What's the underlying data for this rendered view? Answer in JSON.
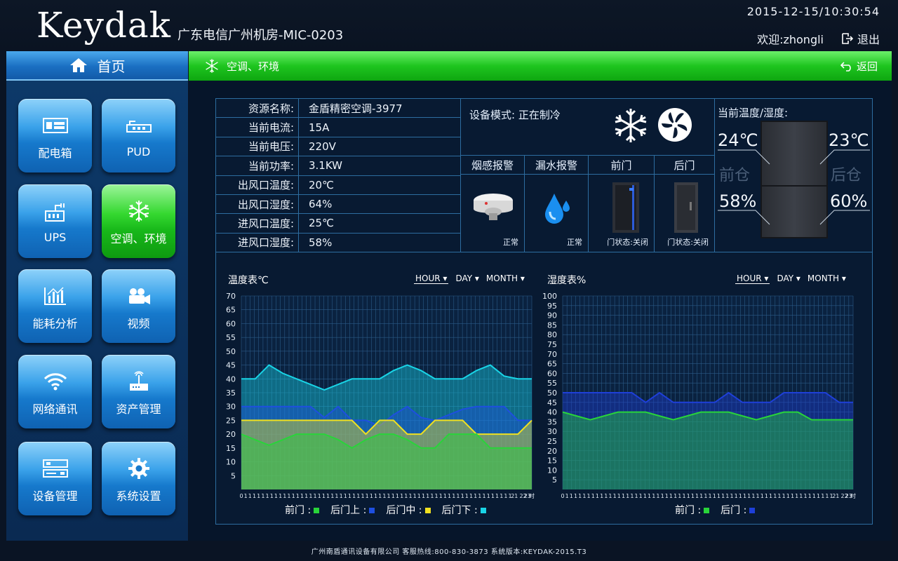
{
  "header": {
    "logo": "Keydak",
    "site_name": "广东电信广州机房-MIC-0203",
    "datetime": "2015-12-15/10:30:54",
    "welcome": "欢迎:zhongli",
    "logout": "退出"
  },
  "sidebar": {
    "home": "首页",
    "tiles": [
      {
        "label": "配电箱",
        "icon": "distribution-box-icon"
      },
      {
        "label": "PUD",
        "icon": "pdu-icon"
      },
      {
        "label": "UPS",
        "icon": "ups-icon"
      },
      {
        "label": "空调、环境",
        "icon": "snowflake-icon",
        "active": true
      },
      {
        "label": "能耗分析",
        "icon": "bar-chart-icon"
      },
      {
        "label": "视频",
        "icon": "camera-icon"
      },
      {
        "label": "网络通讯",
        "icon": "wifi-icon"
      },
      {
        "label": "资产管理",
        "icon": "router-icon"
      },
      {
        "label": "设备管理",
        "icon": "device-icon"
      },
      {
        "label": "系统设置",
        "icon": "gear-icon"
      }
    ]
  },
  "titlebar": {
    "title": "空调、环境",
    "back": "返回"
  },
  "info": [
    {
      "k": "资源名称:",
      "v": "金盾精密空调-3977"
    },
    {
      "k": "当前电流:",
      "v": "15A"
    },
    {
      "k": "当前电压:",
      "v": "220V"
    },
    {
      "k": "当前功率:",
      "v": "3.1KW"
    },
    {
      "k": "出风口温度:",
      "v": "20℃"
    },
    {
      "k": "出风口湿度:",
      "v": "64%"
    },
    {
      "k": "进风口温度:",
      "v": "25℃"
    },
    {
      "k": "进风口湿度:",
      "v": "58%"
    }
  ],
  "mode": {
    "text": "设备模式: 正在制冷"
  },
  "alarms": [
    {
      "title": "烟感报警",
      "status": "正常"
    },
    {
      "title": "漏水报警",
      "status": "正常"
    },
    {
      "title": "前门",
      "status": "门状态:关闭"
    },
    {
      "title": "后门",
      "status": "门状态:关闭"
    }
  ],
  "temp_panel": {
    "title": "当前温度/湿度:",
    "front_temp": "24℃",
    "rear_temp": "23℃",
    "front_label": "前仓",
    "rear_label": "后仓",
    "front_hum": "58%",
    "rear_hum": "60%"
  },
  "range_options": [
    "HOUR",
    "DAY",
    "MONTH"
  ],
  "footer": "广州南盾通讯设备有限公司  客服热线:800-830-3873  系统版本:KEYDAK-2015.T3",
  "chart_data": [
    {
      "type": "area",
      "title": "温度表℃",
      "x": [
        "0",
        "1",
        "1",
        "1",
        "1",
        "1",
        "1",
        "1",
        "1",
        "1",
        "1",
        "1",
        "1",
        "1",
        "1",
        "1",
        "1",
        "1",
        "1",
        "1",
        "1",
        "1",
        "1",
        "1",
        "1",
        "1",
        "1",
        "1",
        "1",
        "1",
        "1",
        "1",
        "1",
        "1",
        "1",
        "1",
        "1",
        "1",
        "1",
        "1",
        "1",
        "1",
        "1",
        "1",
        "1",
        "1",
        "1",
        "1",
        "1",
        "1",
        "1",
        "1",
        "1",
        "1",
        "1",
        "1",
        "1",
        "1",
        "1",
        "1",
        "1",
        "1",
        "1",
        "21",
        "",
        "22",
        "23",
        "时"
      ],
      "ylim": [
        0,
        70
      ],
      "yticks": [
        5,
        10,
        15,
        20,
        25,
        30,
        35,
        40,
        45,
        50,
        55,
        60,
        65,
        70
      ],
      "series": [
        {
          "name": "后门下",
          "color": "#19d4e6",
          "values": [
            40,
            40,
            45,
            42,
            40,
            38,
            36,
            38,
            40,
            40,
            40,
            43,
            45,
            43,
            40,
            40,
            40,
            43,
            45,
            41,
            40,
            40
          ]
        },
        {
          "name": "后门上",
          "color": "#1e4fe0",
          "values": [
            30,
            30,
            30,
            30,
            30,
            30,
            26,
            30,
            25,
            25,
            23,
            27,
            30,
            26,
            25,
            27,
            29,
            30,
            30,
            30,
            25,
            25
          ]
        },
        {
          "name": "后门中",
          "color": "#f0e020",
          "values": [
            25,
            25,
            25,
            25,
            25,
            25,
            25,
            25,
            25,
            20,
            25,
            25,
            20,
            20,
            25,
            25,
            25,
            20,
            20,
            20,
            20,
            25
          ]
        },
        {
          "name": "前门",
          "color": "#29d43a",
          "values": [
            20,
            18,
            16,
            18,
            20,
            20,
            20,
            18,
            15,
            18,
            20,
            20,
            18,
            15,
            15,
            20,
            20,
            20,
            15,
            15,
            15,
            15
          ]
        }
      ],
      "legend": [
        "前门 :",
        "后门上 :",
        "后门中 :",
        "后门下 :"
      ]
    },
    {
      "type": "area",
      "title": "湿度表%",
      "x": [
        "0",
        "1",
        "1",
        "1",
        "1",
        "1",
        "1",
        "1",
        "1",
        "1",
        "1",
        "1",
        "1",
        "1",
        "1",
        "1",
        "1",
        "1",
        "1",
        "1",
        "1",
        "1",
        "1",
        "1",
        "1",
        "1",
        "1",
        "1",
        "1",
        "1",
        "1",
        "1",
        "1",
        "1",
        "1",
        "1",
        "1",
        "1",
        "1",
        "1",
        "1",
        "1",
        "1",
        "1",
        "1",
        "1",
        "1",
        "1",
        "1",
        "1",
        "1",
        "1",
        "1",
        "1",
        "1",
        "1",
        "1",
        "1",
        "1",
        "1",
        "1",
        "1",
        "1",
        "21",
        "",
        "22",
        "23",
        "时"
      ],
      "ylim": [
        0,
        100
      ],
      "yticks": [
        5,
        10,
        15,
        20,
        25,
        30,
        35,
        40,
        45,
        50,
        55,
        60,
        65,
        70,
        75,
        80,
        85,
        90,
        95,
        100
      ],
      "series": [
        {
          "name": "后门",
          "color": "#1e3fd8",
          "values": [
            50,
            50,
            50,
            50,
            50,
            50,
            45,
            50,
            45,
            45,
            45,
            45,
            50,
            45,
            45,
            45,
            50,
            50,
            50,
            50,
            45,
            45
          ]
        },
        {
          "name": "前门",
          "color": "#29d43a",
          "values": [
            40,
            38,
            36,
            38,
            40,
            40,
            40,
            38,
            36,
            38,
            40,
            40,
            40,
            38,
            36,
            38,
            40,
            40,
            36,
            36,
            36,
            36
          ]
        }
      ],
      "legend": [
        "前门 :",
        "后门 :"
      ]
    }
  ]
}
